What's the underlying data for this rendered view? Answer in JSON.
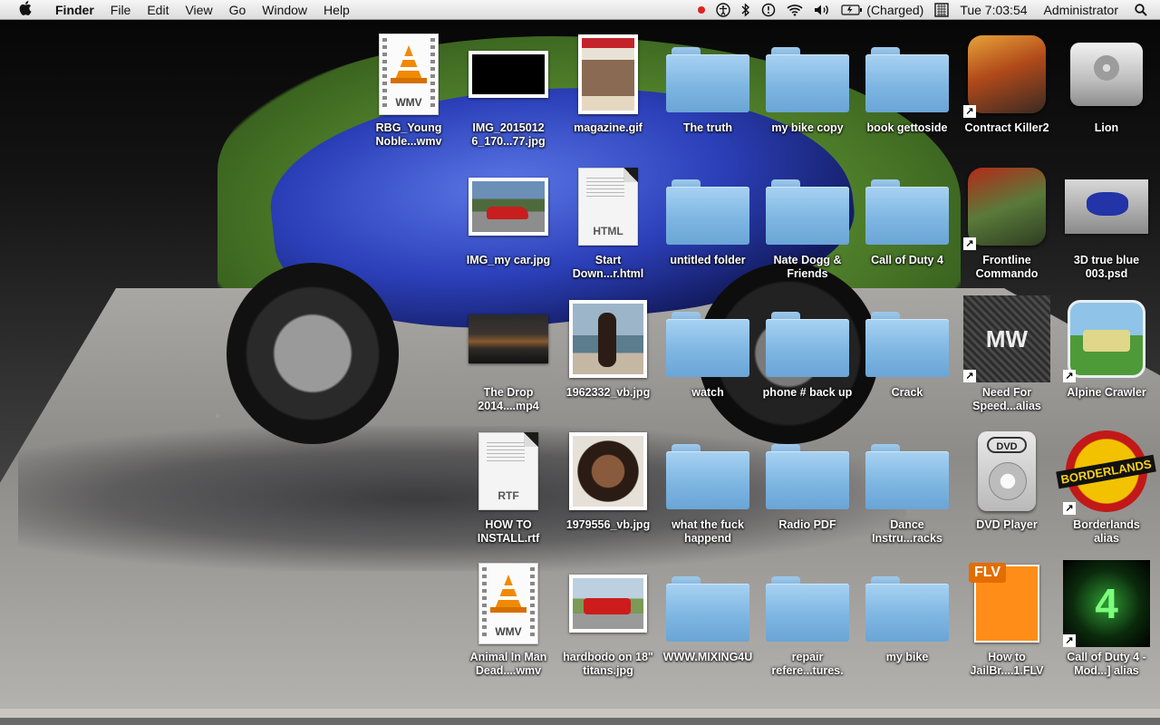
{
  "menubar": {
    "apple_icon": "apple-logo-icon",
    "app_name": "Finder",
    "menus": [
      "File",
      "Edit",
      "View",
      "Go",
      "Window",
      "Help"
    ],
    "status": {
      "battery_text": "(Charged)",
      "clock": "Tue 7:03:54",
      "user": "Administrator"
    }
  },
  "desktop": {
    "icons": [
      {
        "label": "RBG_Young Noble...wmv"
      },
      {
        "label": "IMG_2015012 6_170...77.jpg"
      },
      {
        "label": "magazine.gif"
      },
      {
        "label": "The truth"
      },
      {
        "label": "my bike copy"
      },
      {
        "label": "book gettoside"
      },
      {
        "label": "Contract Killer2"
      },
      {
        "label": "Lion"
      },
      {
        "label": "IMG_my car.jpg"
      },
      {
        "label": "Start Down...r.html",
        "tag": "HTML"
      },
      {
        "label": "untitled folder"
      },
      {
        "label": "Nate Dogg & Friends"
      },
      {
        "label": "Call of Duty 4"
      },
      {
        "label": "Frontline Commando"
      },
      {
        "label": "3D true blue 003.psd"
      },
      {
        "label": "The Drop 2014....mp4"
      },
      {
        "label": "1962332_vb.jpg"
      },
      {
        "label": "watch"
      },
      {
        "label": "phone # back up"
      },
      {
        "label": "Crack"
      },
      {
        "label": "Need For Speed...alias",
        "nfs_text": "MW"
      },
      {
        "label": "Alpine Crawler"
      },
      {
        "label": "HOW TO INSTALL.rtf",
        "tag": "RTF"
      },
      {
        "label": "1979556_vb.jpg"
      },
      {
        "label": "what the fuck happend"
      },
      {
        "label": "Radio PDF"
      },
      {
        "label": "Dance Instru...racks"
      },
      {
        "label": "DVD Player",
        "dvd_text": "DVD"
      },
      {
        "label": "Borderlands alias",
        "logo_text": "BORDERLANDS"
      },
      {
        "label": "Animal In Man Dead....wmv"
      },
      {
        "label": "hardbodo on 18\" titans.jpg"
      },
      {
        "label": "WWW.MIXING4U"
      },
      {
        "label": "repair refere...tures."
      },
      {
        "label": "my bike"
      },
      {
        "label": "How to JailBr....1.FLV",
        "tag": "FLV"
      },
      {
        "label": "Call of Duty 4 - Mod...] alias",
        "cod_text": "4"
      }
    ],
    "file_tags": {
      "wmv": "WMV"
    }
  }
}
